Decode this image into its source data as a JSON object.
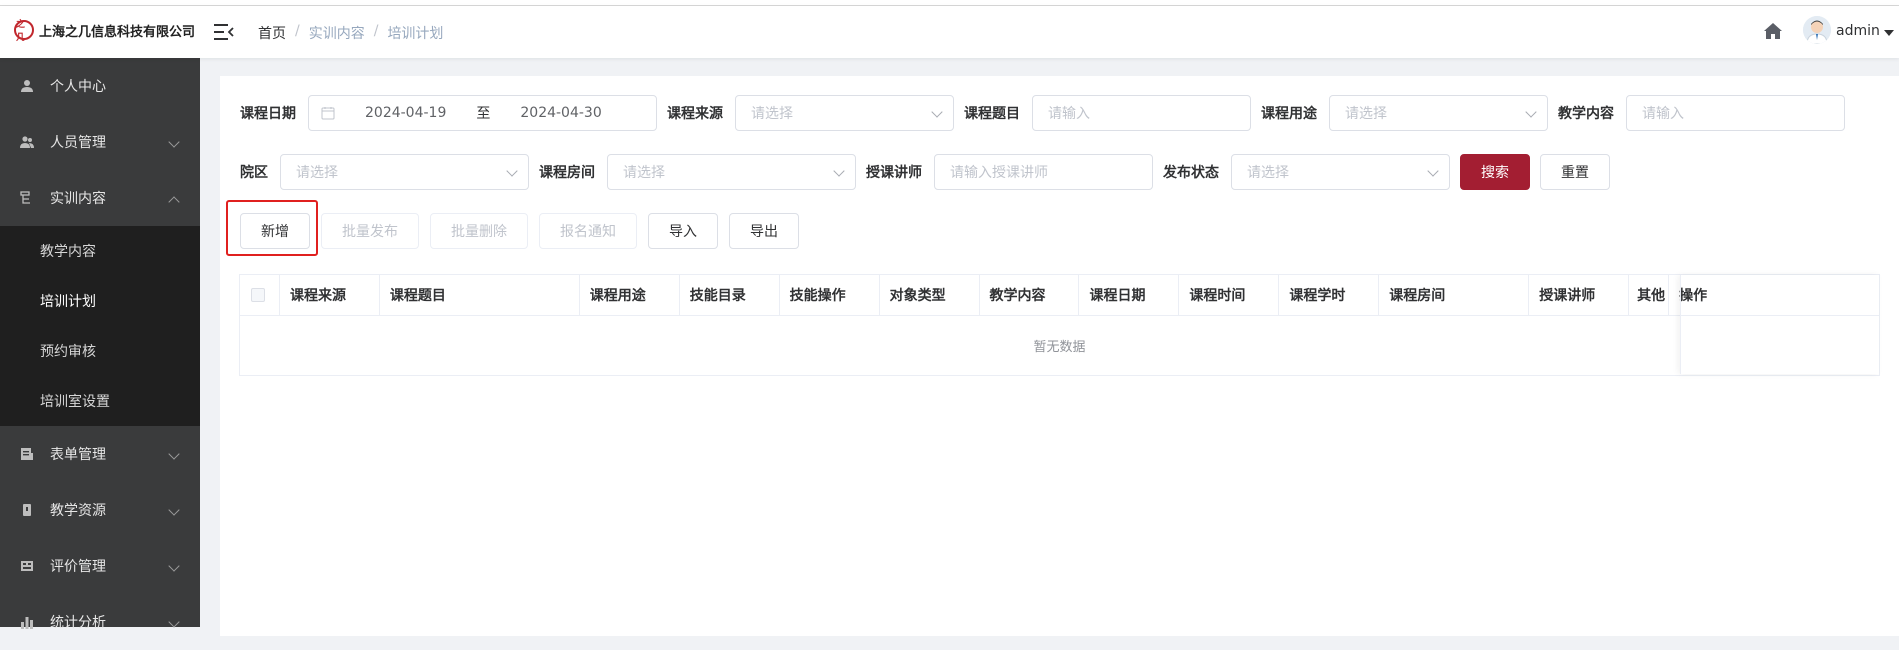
{
  "header": {
    "logo_mark": "之几",
    "company_name": "上海之几信息科技有限公司",
    "breadcrumb": [
      "首页",
      "实训内容",
      "培训计划"
    ],
    "breadcrumb_sep": "/",
    "user_name": "admin"
  },
  "sidebar": {
    "items": [
      {
        "label": "个人中心",
        "icon": "user-icon"
      },
      {
        "label": "人员管理",
        "icon": "users-icon"
      },
      {
        "label": "实训内容",
        "icon": "training-icon",
        "expanded": true,
        "children": [
          "教学内容",
          "培训计划",
          "预约审核",
          "培训室设置"
        ],
        "active_child": "培训计划"
      },
      {
        "label": "表单管理",
        "icon": "form-icon"
      },
      {
        "label": "教学资源",
        "icon": "resource-icon"
      },
      {
        "label": "评价管理",
        "icon": "evaluation-icon"
      },
      {
        "label": "统计分析",
        "icon": "chart-icon"
      }
    ]
  },
  "filters": {
    "course_date": {
      "label": "课程日期",
      "start": "2024-04-19",
      "range_sep": "至",
      "end": "2024-04-30"
    },
    "course_source": {
      "label": "课程来源",
      "placeholder": "请选择"
    },
    "course_topic": {
      "label": "课程题目",
      "placeholder": "请输入"
    },
    "course_use": {
      "label": "课程用途",
      "placeholder": "请选择"
    },
    "teaching_content": {
      "label": "教学内容",
      "placeholder": "请输入"
    },
    "campus": {
      "label": "院区",
      "placeholder": "请选择"
    },
    "course_room": {
      "label": "课程房间",
      "placeholder": "请选择"
    },
    "lecturer": {
      "label": "授课讲师",
      "placeholder": "请输入授课讲师"
    },
    "publish_status": {
      "label": "发布状态",
      "placeholder": "请选择"
    },
    "search_label": "搜索",
    "reset_label": "重置"
  },
  "toolbar": {
    "add": "新增",
    "batch_publish": "批量发布",
    "batch_delete": "批量删除",
    "signup_notice": "报名通知",
    "import": "导入",
    "export": "导出"
  },
  "table": {
    "columns": [
      "课程来源",
      "课程题目",
      "课程用途",
      "技能目录",
      "技能操作",
      "对象类型",
      "教学内容",
      "课程日期",
      "课程时间",
      "课程学时",
      "课程房间",
      "授课讲师",
      "其他",
      "操作"
    ],
    "empty_text": "暂无数据"
  },
  "colors": {
    "primary": "#a31e32",
    "sidebar_bg": "#3a3b3c",
    "submenu_bg": "#1f1f1f",
    "highlight_box": "#e0201f"
  }
}
